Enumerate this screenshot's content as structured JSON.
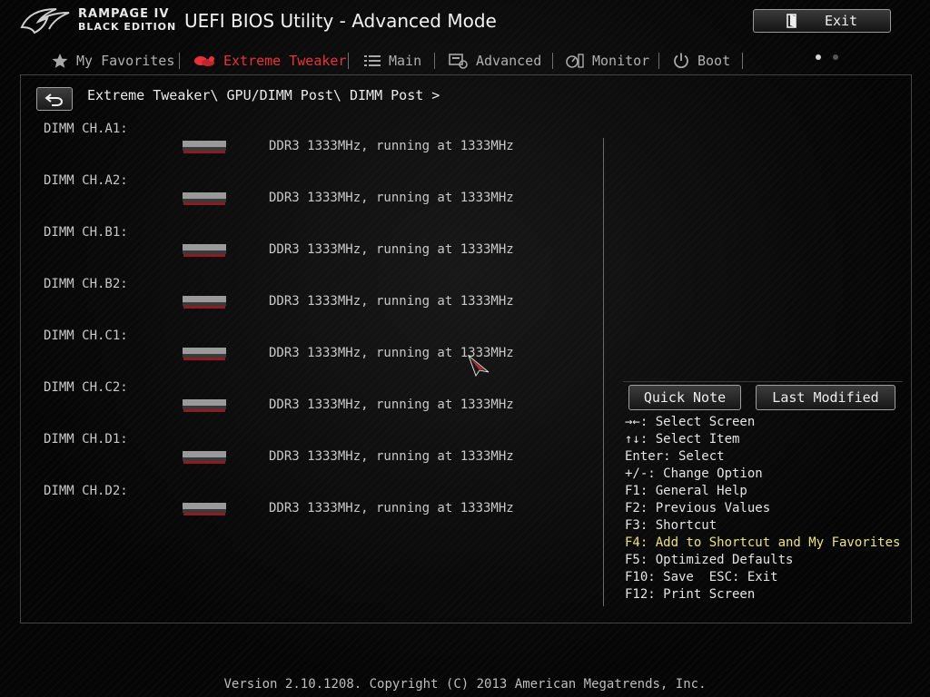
{
  "header": {
    "brand_line1": "RAMPAGE IV",
    "brand_line2": "BLACK EDITION",
    "title": "UEFI BIOS Utility - Advanced Mode",
    "exit_label": "Exit"
  },
  "tabs": [
    {
      "label": "My Favorites",
      "icon": "star-icon",
      "active": false
    },
    {
      "label": "Extreme Tweaker",
      "icon": "tweaker-icon",
      "active": true
    },
    {
      "label": "Main",
      "icon": "list-icon",
      "active": false
    },
    {
      "label": "Advanced",
      "icon": "advanced-icon",
      "active": false
    },
    {
      "label": "Monitor",
      "icon": "monitor-icon",
      "active": false
    },
    {
      "label": "Boot",
      "icon": "power-icon",
      "active": false
    }
  ],
  "breadcrumb": "Extreme Tweaker\\ GPU/DIMM Post\\ DIMM Post >",
  "dimms": [
    {
      "label": "DIMM CH.A1:",
      "value": "DDR3 1333MHz, running at 1333MHz"
    },
    {
      "label": "DIMM CH.A2:",
      "value": "DDR3 1333MHz, running at 1333MHz"
    },
    {
      "label": "DIMM CH.B1:",
      "value": "DDR3 1333MHz, running at 1333MHz"
    },
    {
      "label": "DIMM CH.B2:",
      "value": "DDR3 1333MHz, running at 1333MHz"
    },
    {
      "label": "DIMM CH.C1:",
      "value": "DDR3 1333MHz, running at 1333MHz"
    },
    {
      "label": "DIMM CH.C2:",
      "value": "DDR3 1333MHz, running at 1333MHz"
    },
    {
      "label": "DIMM CH.D1:",
      "value": "DDR3 1333MHz, running at 1333MHz"
    },
    {
      "label": "DIMM CH.D2:",
      "value": "DDR3 1333MHz, running at 1333MHz"
    }
  ],
  "sidebar": {
    "quick_note": "Quick Note",
    "last_modified": "Last Modified",
    "help": [
      {
        "text": "→←: Select Screen",
        "highlight": false
      },
      {
        "text": "↑↓: Select Item",
        "highlight": false
      },
      {
        "text": "Enter: Select",
        "highlight": false
      },
      {
        "text": "+/-: Change Option",
        "highlight": false
      },
      {
        "text": "F1: General Help",
        "highlight": false
      },
      {
        "text": "F2: Previous Values",
        "highlight": false
      },
      {
        "text": "F3: Shortcut",
        "highlight": false
      },
      {
        "text": "F4: Add to Shortcut and My Favorites",
        "highlight": true
      },
      {
        "text": "F5: Optimized Defaults",
        "highlight": false
      },
      {
        "text": "F10: Save  ESC: Exit",
        "highlight": false
      },
      {
        "text": "F12: Print Screen",
        "highlight": false
      }
    ]
  },
  "footer": "Version 2.10.1208. Copyright (C) 2013 American Megatrends, Inc.",
  "colors": {
    "active_tab": "#e8323a",
    "highlight_help": "#ece37a",
    "background": "#050505"
  }
}
